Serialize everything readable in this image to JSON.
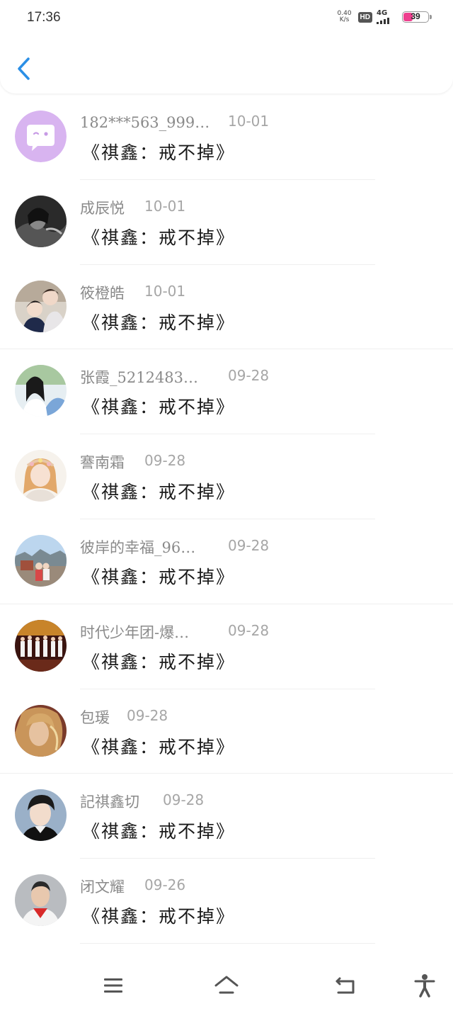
{
  "status_bar": {
    "time": "17:36",
    "net_speed_value": "0.40",
    "net_speed_unit": "K/s",
    "hd": "HD",
    "network_type": "4G",
    "battery": "39",
    "battery_color": "#ee3f8e"
  },
  "header": {
    "back_icon": "chevron-left-icon",
    "accent": "#2b8fe6"
  },
  "items": [
    {
      "name": "182***563_999…",
      "date": "10-01",
      "content": "《祺鑫：戒不掉》",
      "avatar": "chat-bubble-icon"
    },
    {
      "name": "成辰悦",
      "date": "10-01",
      "content": "《祺鑫：戒不掉》",
      "avatar": "user-photo"
    },
    {
      "name": "筱橙皓",
      "date": "10-01",
      "content": "《祺鑫：戒不掉》",
      "avatar": "user-photo"
    },
    {
      "name": "张霞_5212483…",
      "date": "09-28",
      "content": "《祺鑫：戒不掉》",
      "avatar": "user-photo"
    },
    {
      "name": "謇南霜",
      "date": "09-28",
      "content": "《祺鑫：戒不掉》",
      "avatar": "user-photo"
    },
    {
      "name": "彼岸的幸福_96…",
      "date": "09-28",
      "content": "《祺鑫：戒不掉》",
      "avatar": "user-photo"
    },
    {
      "name": "时代少年团-爆…",
      "date": "09-28",
      "content": "《祺鑫：戒不掉》",
      "avatar": "user-photo"
    },
    {
      "name": "包瑗",
      "date": "09-28",
      "content": "《祺鑫：戒不掉》",
      "avatar": "user-photo"
    },
    {
      "name": "記祺鑫切",
      "date": "09-28",
      "content": "《祺鑫：戒不掉》",
      "avatar": "user-photo"
    },
    {
      "name": "闭文耀",
      "date": "09-26",
      "content": "《祺鑫：戒不掉》",
      "avatar": "user-photo"
    }
  ],
  "navbar": {
    "icons": [
      "menu-icon",
      "home-icon",
      "back-icon",
      "accessibility-icon"
    ]
  }
}
